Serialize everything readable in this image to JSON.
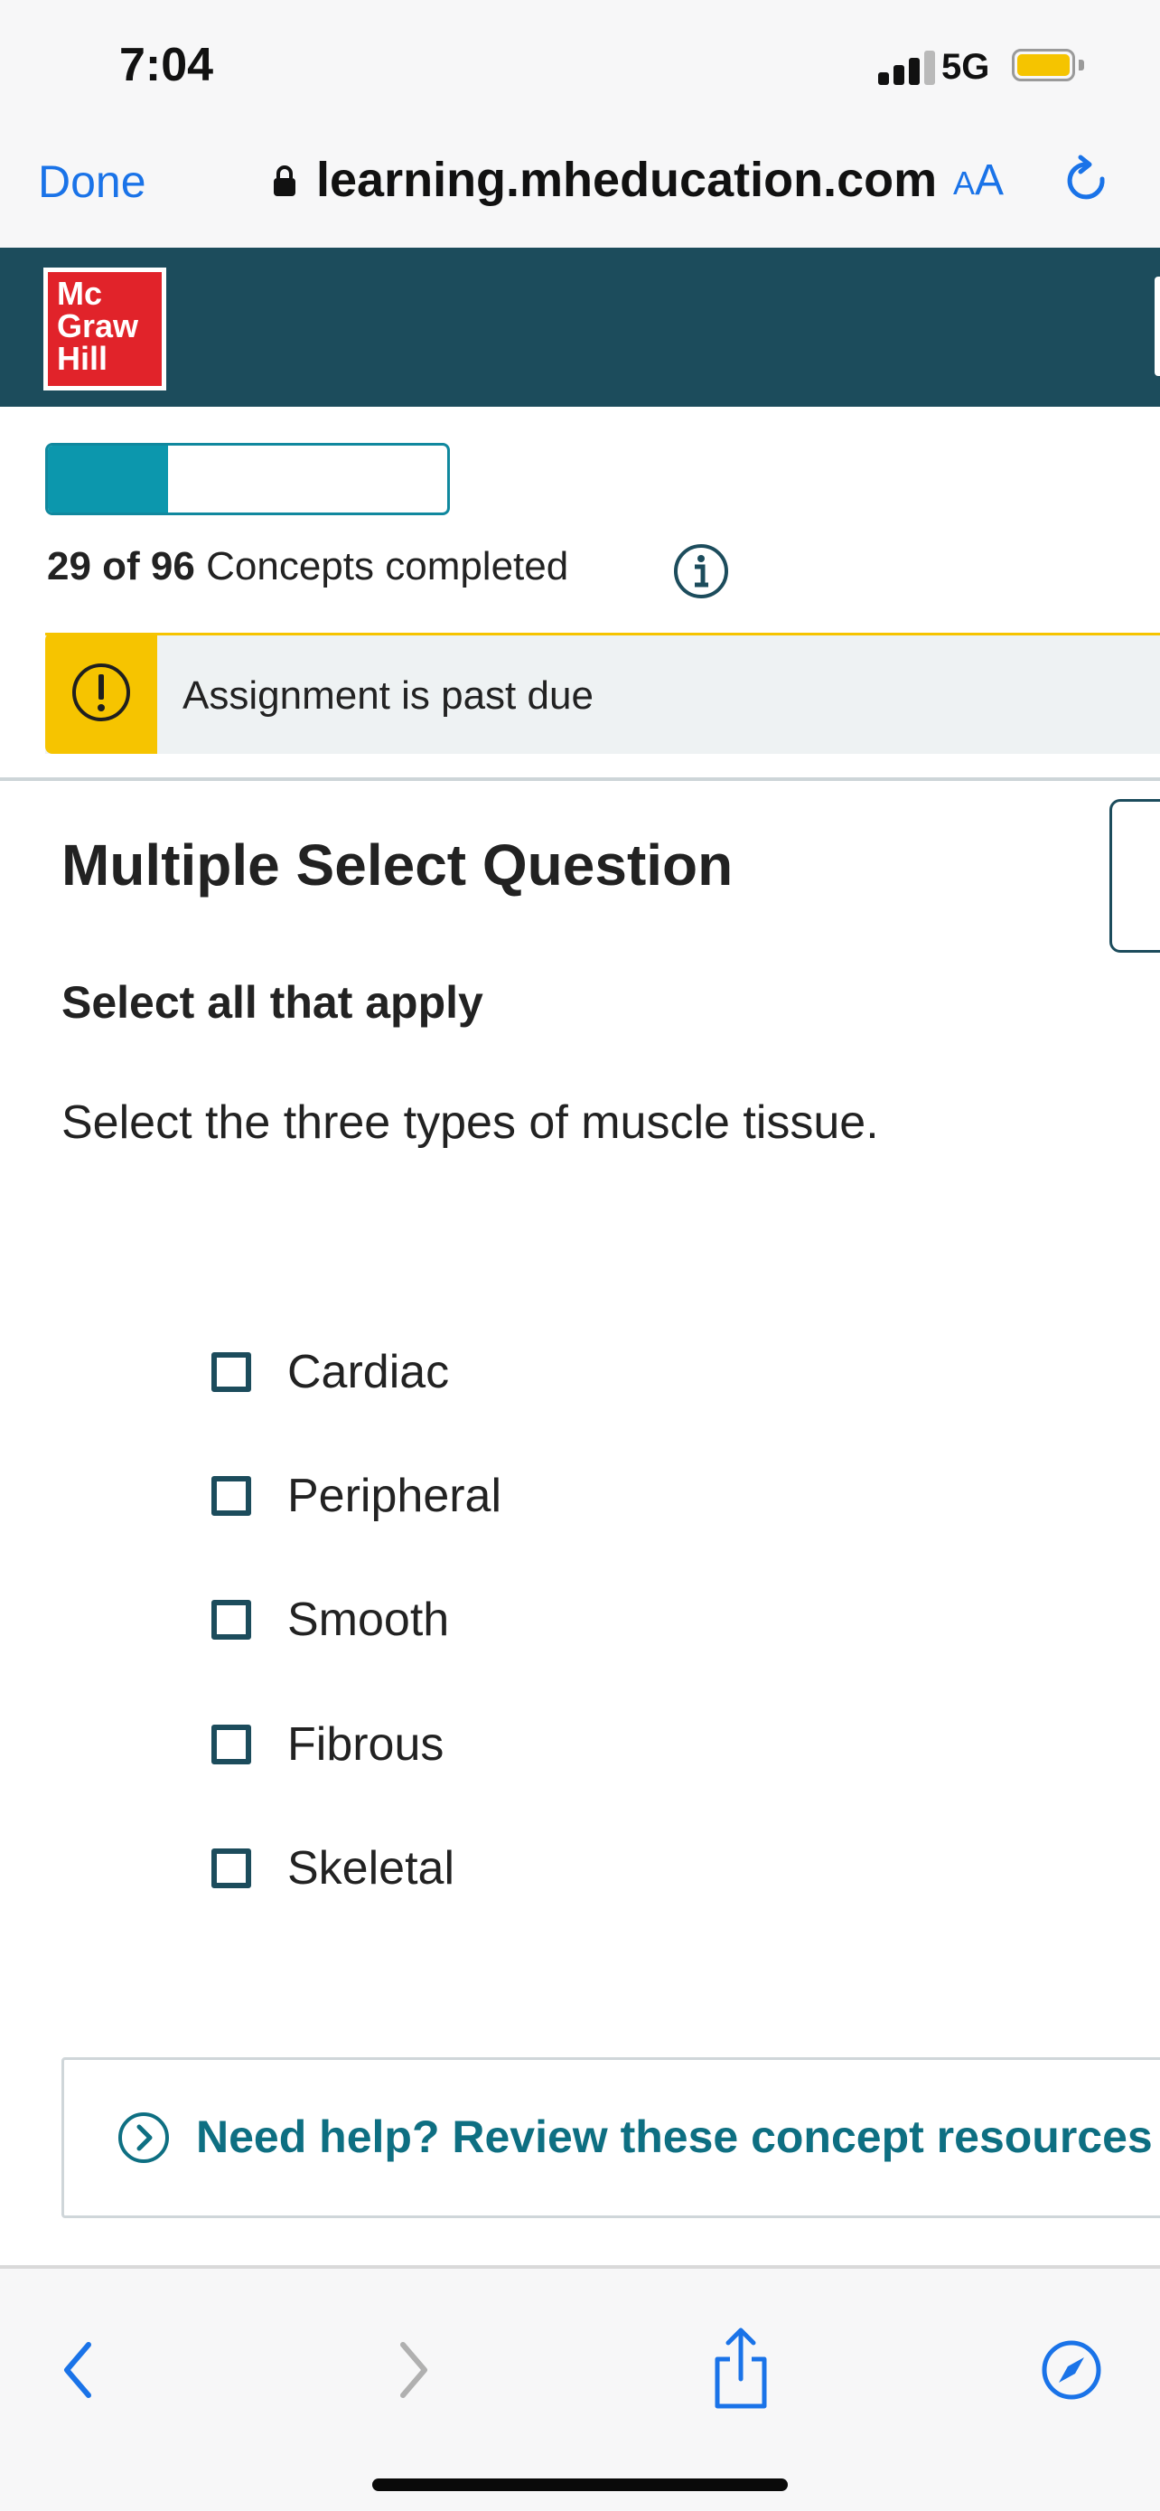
{
  "status_bar": {
    "time": "7:04",
    "network": "5G",
    "battery_color": "#f5c400"
  },
  "browser": {
    "done_label": "Done",
    "url": "learning.mheducation.com",
    "text_size_label_small": "A",
    "text_size_label_large": "A",
    "lock_icon": "lock-icon",
    "reload_icon": "reload-icon"
  },
  "brand": {
    "logo_lines": [
      "Mc",
      "Graw",
      "Hill"
    ],
    "color": "#1c4c5c",
    "logo_color": "#e1232a"
  },
  "progress": {
    "completed": 29,
    "total": 96,
    "count_text": "29 of 96",
    "label": "Concepts completed",
    "fraction": 0.302,
    "accent": "#0c97ad"
  },
  "alert": {
    "text": "Assignment is past due",
    "icon": "warning-icon",
    "color": "#f6c400"
  },
  "question": {
    "type_title": "Multiple Select Question",
    "instruction": "Select all that apply",
    "prompt": "Select the three types of muscle tissue.",
    "options": [
      {
        "label": "Cardiac",
        "checked": false
      },
      {
        "label": "Peripheral",
        "checked": false
      },
      {
        "label": "Smooth",
        "checked": false
      },
      {
        "label": "Fibrous",
        "checked": false
      },
      {
        "label": "Skeletal",
        "checked": false
      }
    ]
  },
  "help": {
    "text": "Need help? Review these concept resources",
    "icon": "chevron-right-circle-icon"
  },
  "toolbar": {
    "icons": [
      "back-icon",
      "forward-icon",
      "share-icon",
      "compass-icon"
    ]
  }
}
